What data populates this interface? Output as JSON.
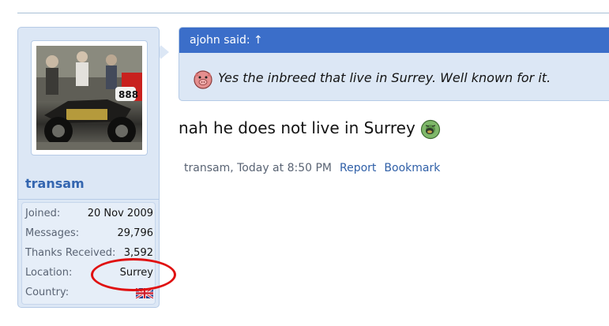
{
  "user": {
    "name": "transam",
    "info": [
      {
        "label": "Joined:",
        "value": "20 Nov 2009"
      },
      {
        "label": "Messages:",
        "value": "29,796"
      },
      {
        "label": "Thanks Received:",
        "value": "3,592"
      },
      {
        "label": "Location:",
        "value": "Surrey"
      },
      {
        "label": "Country:",
        "value": "uk-flag-icon"
      }
    ]
  },
  "quote": {
    "header": "ajohn said: ↑",
    "text": "Yes the inbreed that live in Surrey. Well known for it.",
    "emoji": "pig-face-icon"
  },
  "message": {
    "text": "nah he does not live in Surrey",
    "emoji": "sick-face-icon"
  },
  "footer": {
    "meta": "transam, Today at 8:50 PM",
    "report_label": "Report",
    "bookmark_label": "Bookmark"
  },
  "colors": {
    "accent": "#3b6ec9",
    "link": "#2f5fa7",
    "highlight": "#e01010"
  }
}
